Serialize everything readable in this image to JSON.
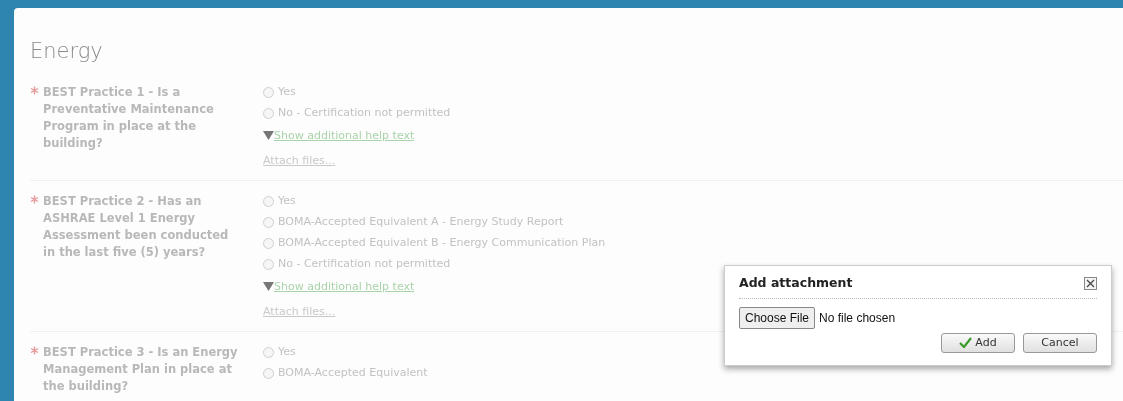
{
  "section": {
    "title": "Energy"
  },
  "questions": [
    {
      "label": "BEST Practice 1 - Is a Preventative Maintenance Program in place at the building?",
      "required": true,
      "options": [
        {
          "label": "Yes",
          "selected": false
        },
        {
          "label": "No - Certification not permitted",
          "selected": false
        }
      ],
      "help_link": "Show additional help text",
      "attach_link": "Attach files..."
    },
    {
      "label": "BEST Practice 2 - Has an ASHRAE Level 1 Energy Assessment been conducted in the last five (5) years?",
      "required": true,
      "options": [
        {
          "label": "Yes",
          "selected": false
        },
        {
          "label": "BOMA-Accepted Equivalent A - Energy Study Report",
          "selected": false
        },
        {
          "label": "BOMA-Accepted Equivalent B - Energy Communication Plan",
          "selected": false
        },
        {
          "label": "No - Certification not permitted",
          "selected": false
        }
      ],
      "help_link": "Show additional help text",
      "attach_link": "Attach files..."
    },
    {
      "label": "BEST Practice 3 - Is an Energy Management Plan in place at the building?",
      "required": true,
      "options": [
        {
          "label": "Yes",
          "selected": false
        },
        {
          "label": "BOMA-Accepted Equivalent",
          "selected": false
        }
      ]
    }
  ],
  "dialog": {
    "title": "Add attachment",
    "file_button": "Choose File",
    "file_status": "No file chosen",
    "buttons": [
      {
        "label": "Add",
        "kind": "confirm"
      },
      {
        "label": "Cancel",
        "kind": "cancel"
      }
    ]
  }
}
